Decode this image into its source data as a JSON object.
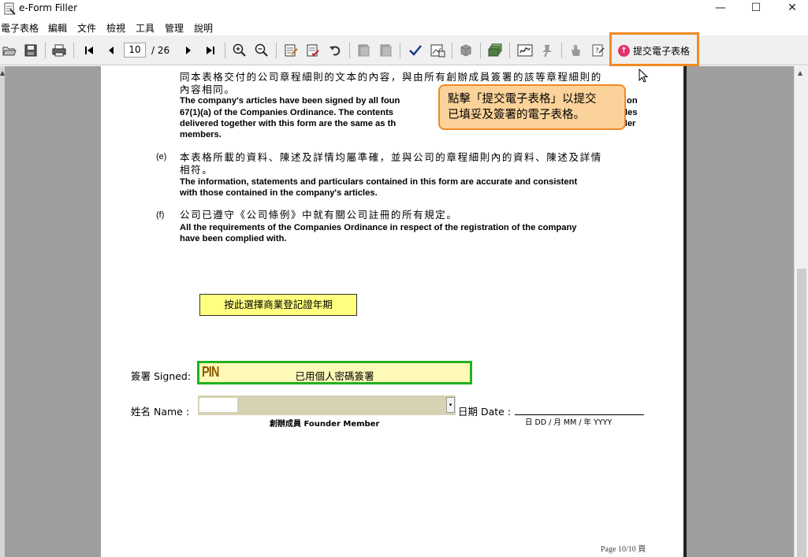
{
  "window": {
    "title": "e-Form Filler",
    "minimize": "—",
    "maximize": "☐",
    "close": "✕"
  },
  "menu": {
    "items": [
      "電子表格",
      "編輯",
      "文件",
      "檢視",
      "工具",
      "管理",
      "說明"
    ]
  },
  "toolbar": {
    "page_current": "10",
    "page_total": "/ 26",
    "submit_label": "提交電子表格",
    "icons": [
      "open-icon",
      "save-icon",
      "print-icon",
      "first-page-icon",
      "prev-page-icon",
      "next-page-icon",
      "last-page-icon",
      "zoom-in-icon",
      "zoom-out-icon",
      "edit-form-icon",
      "check-form-icon",
      "undo-icon",
      "prev-form-icon",
      "next-form-icon",
      "validate-icon",
      "attachment-icon",
      "cube-icon",
      "layers-icon",
      "sign-icon",
      "pin-icon",
      "hand-icon",
      "help-icon"
    ]
  },
  "callout": {
    "text_line1": "點擊「提交電子表格」以提交",
    "text_line2": "已填妥及簽署的電子表格。"
  },
  "document": {
    "para_d_zh_1": "同本表格交付的公司章程細則的文本的內容，與由所有創辦成員簽署的該等章程細則的",
    "para_d_zh_2": "內容相同。",
    "para_d_en_1": "The company's articles have been signed by all foun",
    "para_d_en_1_end": "on",
    "para_d_en_2": "67(1)(a) of the Companies Ordinance.  The contents",
    "para_d_en_2_end": "les",
    "para_d_en_3": "delivered together with this form are the same as th",
    "para_d_en_3_end": "der",
    "para_d_en_4": "members.",
    "label_e": "(e)",
    "para_e_zh_1": "本表格所載的資料、陳述及詳情均屬準確，並與公司的章程細則內的資料、陳述及詳情",
    "para_e_zh_2": "相符。",
    "para_e_en_1": "The information, statements and particulars contained in this form are accurate and consistent",
    "para_e_en_2": "with those contained in the company's articles.",
    "label_f": "(f)",
    "para_f_zh": "公司已遵守《公司條例》中就有關公司註冊的所有規定。",
    "para_f_en_1": "All the requirements of the Companies Ordinance in respect of the registration of the company",
    "para_f_en_2": "have been complied with.",
    "br_year_button": "按此選擇商業登記證年期",
    "signed_label": "簽署  Signed:",
    "pin_text": "PIN",
    "signed_value": "已用個人密碼簽署",
    "name_label": "姓名  Name  :",
    "founder_label": "創辦成員  Founder Member",
    "date_label": "日期  Date   :",
    "date_format": "日 DD    /   月 MM    /    年 YYYY",
    "page_footer": "Page 10/10 頁"
  },
  "colors": {
    "accent_orange": "#f08a24",
    "callout_bg": "#fbd39a",
    "signed_border": "#22b022",
    "signed_bg": "#fff9b8",
    "button_yellow": "#ffff80",
    "upload_pink": "#e2336b"
  }
}
